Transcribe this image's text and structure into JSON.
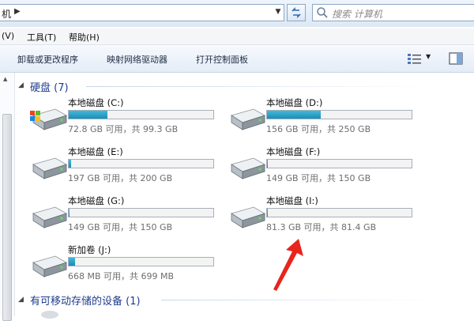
{
  "address": {
    "path": "机",
    "back_arrow": "▶"
  },
  "search": {
    "placeholder": "搜索 计算机"
  },
  "menu": [
    "(V)",
    "工具(T)",
    "帮助(H)"
  ],
  "commands": [
    "卸载或更改程序",
    "映射网络驱动器",
    "打开控制面板"
  ],
  "groups": {
    "hard_disks": {
      "title": "硬盘 (7)"
    },
    "removable": {
      "title": "有可移动存储的设备 (1)"
    }
  },
  "drives": [
    {
      "name": "本地磁盘 (C:)",
      "info": "72.8 GB 可用，共 99.3 GB",
      "used_fraction": 0.27,
      "system": true
    },
    {
      "name": "本地磁盘 (D:)",
      "info": "156 GB 可用，共 250 GB",
      "used_fraction": 0.37
    },
    {
      "name": "本地磁盘 (E:)",
      "info": "197 GB 可用，共 200 GB",
      "used_fraction": 0.015
    },
    {
      "name": "本地磁盘 (F:)",
      "info": "149 GB 可用，共 150 GB",
      "used_fraction": 0.007
    },
    {
      "name": "本地磁盘 (G:)",
      "info": "149 GB 可用，共 150 GB",
      "used_fraction": 0.007
    },
    {
      "name": "本地磁盘 (I:)",
      "info": "81.3 GB 可用，共 81.4 GB",
      "used_fraction": 0.001
    },
    {
      "name": "新加卷 (J:)",
      "info": "668 MB 可用，共 699 MB",
      "used_fraction": 0.045
    }
  ],
  "colors": {
    "bar_fill": "#26a0c9",
    "group_title": "#1e3d8f",
    "annotation_arrow": "#e8241c"
  }
}
